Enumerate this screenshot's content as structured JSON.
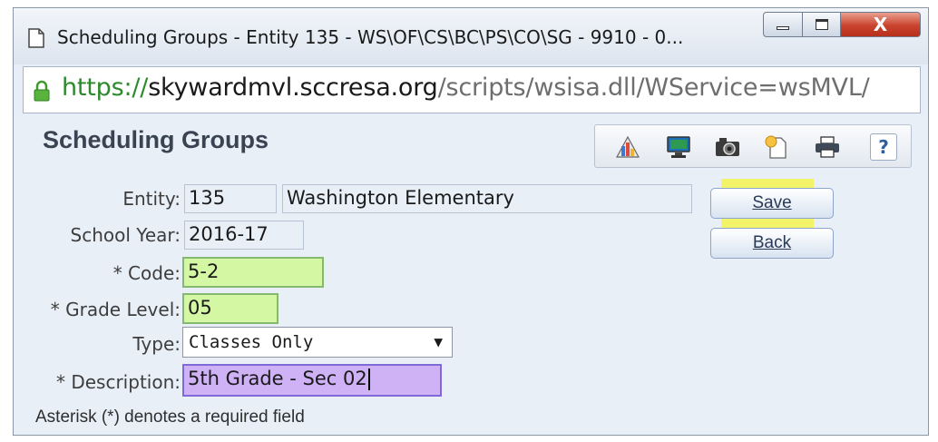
{
  "window": {
    "title": "Scheduling Groups - Entity 135 - WS\\OF\\CS\\BC\\PS\\CO\\SG - 9910 - 0...",
    "close_glyph": "X"
  },
  "address": {
    "scheme": "https://",
    "host": "skywardmvl.sccresa.org",
    "path": "/scripts/wsisa.dll/WService=wsMVL/"
  },
  "page": {
    "title": "Scheduling Groups"
  },
  "toolbar": {
    "icons": [
      "map-report-icon",
      "monitor-icon",
      "camera-icon",
      "note-icon",
      "printer-icon",
      "help-icon"
    ],
    "help_glyph": "?"
  },
  "form": {
    "entity_label": "Entity:",
    "entity_code": "135",
    "entity_name": "Washington Elementary",
    "school_year_label": "School Year:",
    "school_year": "2016-17",
    "code_label": "* Code:",
    "code_value": "5-2",
    "grade_level_label": "* Grade Level:",
    "grade_level_value": "05",
    "type_label": "Type:",
    "type_value": "Classes Only",
    "description_label": "* Description:",
    "description_value": "5th Grade - Sec 02"
  },
  "buttons": {
    "save": "Save",
    "back": "Back"
  },
  "footer": {
    "note": "Asterisk (*) denotes a required field"
  },
  "colors": {
    "required_green": "#d4f7a3",
    "active_purple": "#cfb1f6",
    "highlight": "#f6f43a",
    "close_red": "#c9432d"
  }
}
